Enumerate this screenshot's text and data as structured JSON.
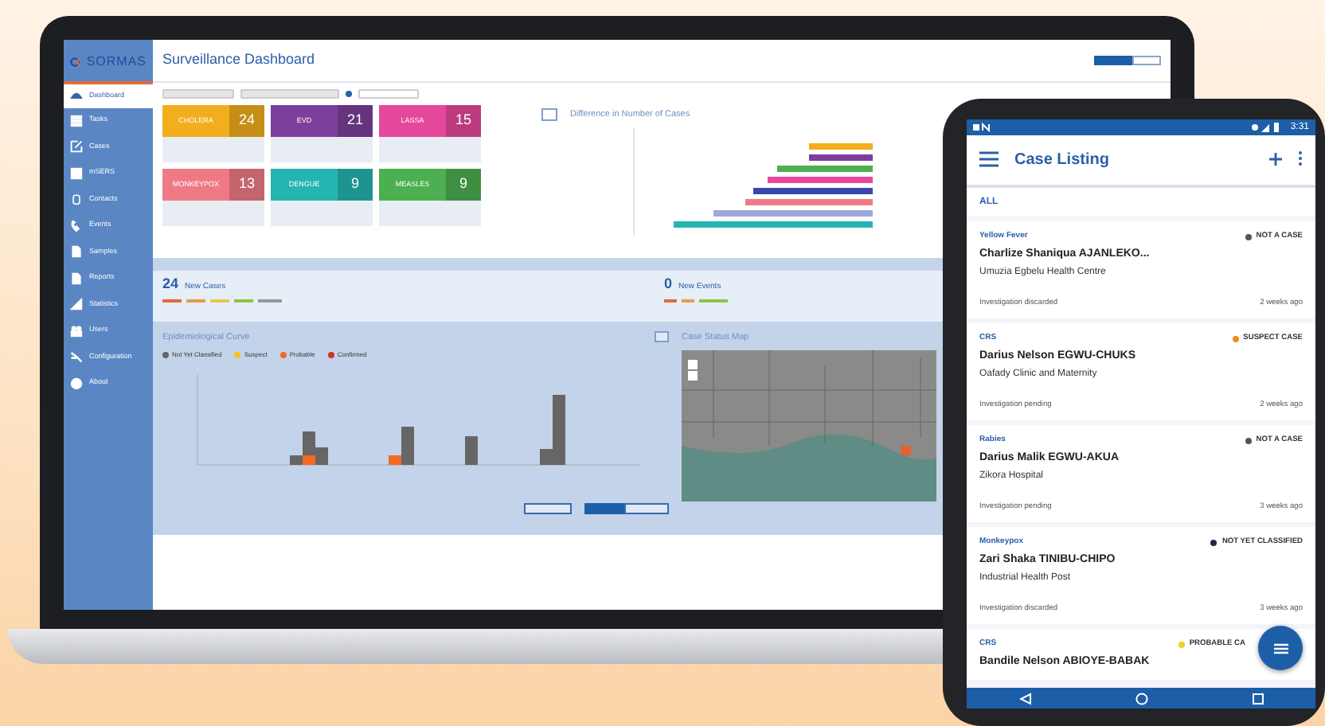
{
  "laptop": {
    "logo": "SORMAS",
    "title": "Surveillance Dashboard",
    "sidebar": {
      "items": [
        {
          "label": "Dashboard",
          "selected": true
        },
        {
          "label": "Tasks",
          "selected": false
        },
        {
          "label": "Cases",
          "selected": false
        },
        {
          "label": "mSERS",
          "selected": false
        },
        {
          "label": "Contacts",
          "selected": false
        },
        {
          "label": "Events",
          "selected": false
        },
        {
          "label": "Samples",
          "selected": false
        },
        {
          "label": "Reports",
          "selected": false
        },
        {
          "label": "Statistics",
          "selected": false
        },
        {
          "label": "Users",
          "selected": false
        },
        {
          "label": "Configuration",
          "selected": false
        },
        {
          "label": "About",
          "selected": false
        }
      ]
    },
    "disease_cards": [
      {
        "name": "CHOLERA",
        "count": "24",
        "color": "#f2ae1c"
      },
      {
        "name": "EVD",
        "count": "21",
        "color": "#7d3f9c"
      },
      {
        "name": "LASSA",
        "count": "15",
        "color": "#e5489b"
      },
      {
        "name": "MONKEYPOX",
        "count": "13",
        "color": "#ef7a86"
      },
      {
        "name": "DENGUE",
        "count": "9",
        "color": "#25b5b0"
      },
      {
        "name": "MEASLES",
        "count": "9",
        "color": "#4caf50"
      }
    ],
    "difference_chart": {
      "title": "Difference in Number of Cases"
    },
    "new_cases": {
      "count": "24",
      "label": "New Cases"
    },
    "new_events": {
      "count": "0",
      "label": "New Events"
    },
    "epi_curve": {
      "title": "Epidemiological Curve",
      "legend": [
        {
          "label": "Not Yet Classified",
          "color": "#666666"
        },
        {
          "label": "Suspect",
          "color": "#f2c21c"
        },
        {
          "label": "Probable",
          "color": "#f26a22"
        },
        {
          "label": "Confirmed",
          "color": "#d0342c"
        }
      ]
    },
    "map": {
      "title": "Case Status Map"
    }
  },
  "phone": {
    "time": "3:31",
    "title": "Case Listing",
    "filter": "ALL",
    "cases": [
      {
        "disease": "Yellow Fever",
        "classification": "NOT A CASE",
        "color": "#555555",
        "name": "Charlize Shaniqua AJANLEKO...",
        "facility": "Umuzia Egbelu Health Centre",
        "status": "Investigation discarded",
        "time": "2 weeks ago"
      },
      {
        "disease": "CRS",
        "classification": "SUSPECT CASE",
        "color": "#f28a22",
        "name": "Darius Nelson EGWU-CHUKS",
        "facility": "Oafady Clinic and Maternity",
        "status": "Investigation pending",
        "time": "2 weeks ago"
      },
      {
        "disease": "Rabies",
        "classification": "NOT A CASE",
        "color": "#555555",
        "name": "Darius Malik EGWU-AKUA",
        "facility": "Zikora Hospital",
        "status": "Investigation pending",
        "time": "3 weeks ago"
      },
      {
        "disease": "Monkeypox",
        "classification": "NOT YET CLASSIFIED",
        "color": "#1d2a4a",
        "name": "Zari Shaka TINIBU-CHIPO",
        "facility": "Industrial Health Post",
        "status": "Investigation discarded",
        "time": "3 weeks ago"
      },
      {
        "disease": "CRS",
        "classification": "PROBABLE CA",
        "color": "#f2d21c",
        "name": "Bandile Nelson ABIOYE-BABAK"
      }
    ]
  }
}
